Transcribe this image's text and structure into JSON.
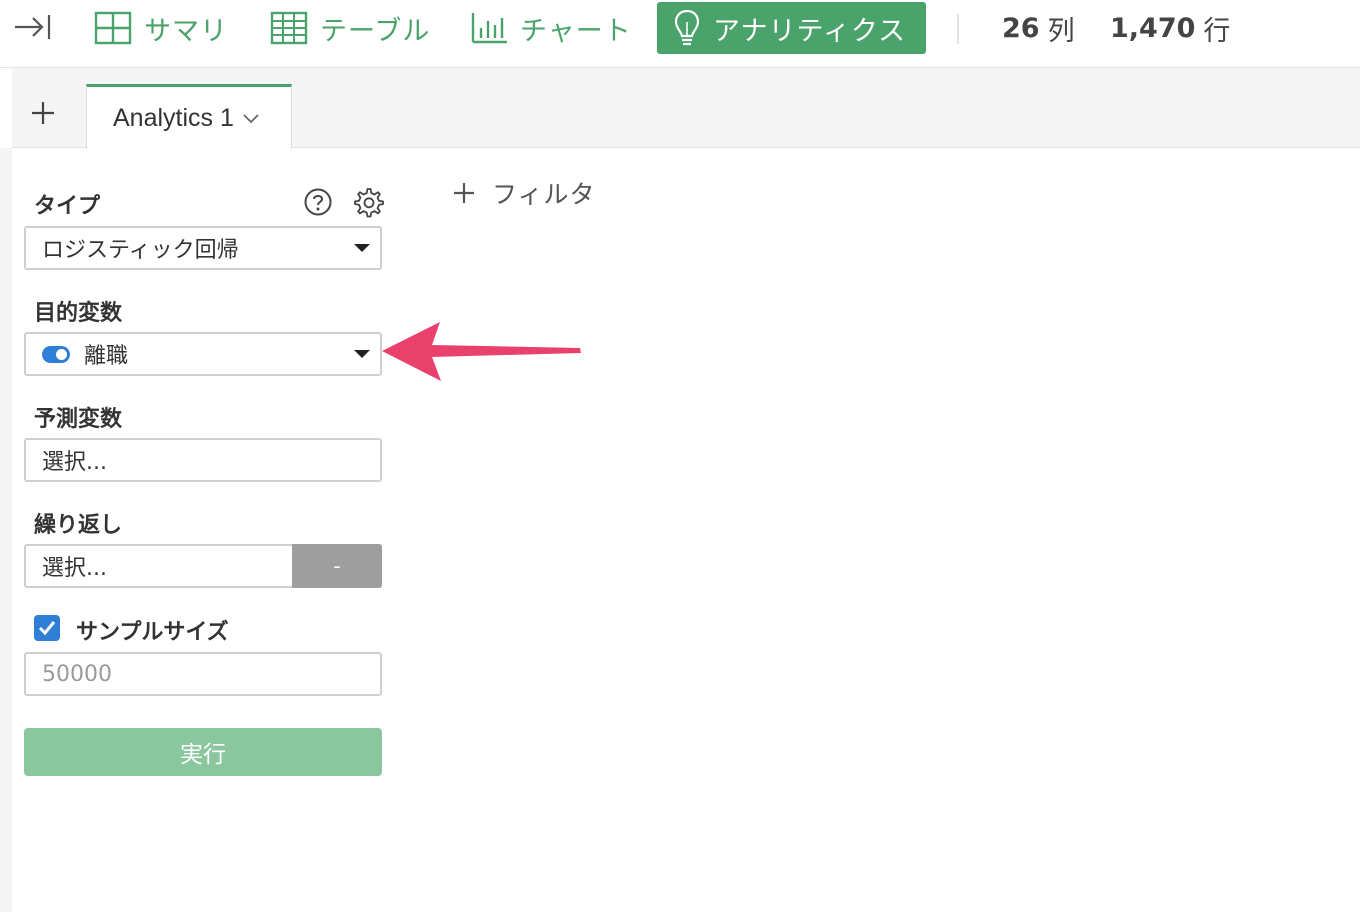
{
  "toolbar": {
    "nav": [
      {
        "label": "サマリ",
        "icon": "summary-grid-icon"
      },
      {
        "label": "テーブル",
        "icon": "table-icon"
      },
      {
        "label": "チャート",
        "icon": "bar-chart-icon"
      },
      {
        "label": "アナリティクス",
        "icon": "lightbulb-icon",
        "active": true
      }
    ],
    "columns": {
      "value": "26",
      "unit": "列"
    },
    "rows": {
      "value": "1,470",
      "unit": "行"
    }
  },
  "tabs": {
    "items": [
      {
        "label": "Analytics 1"
      }
    ]
  },
  "panel": {
    "type": {
      "label": "タイプ",
      "selected": "ロジスティック回帰"
    },
    "target": {
      "label": "目的変数",
      "selected": "離職"
    },
    "predictors": {
      "label": "予測変数",
      "placeholder": "選択..."
    },
    "repeat": {
      "label": "繰り返し",
      "placeholder": "選択...",
      "button": "-"
    },
    "sample_size": {
      "label": "サンプルサイズ",
      "checked": true,
      "placeholder": "50000"
    },
    "run_button": "実行"
  },
  "filter": {
    "label": "フィルタ"
  },
  "colors": {
    "accent": "#4aa36a",
    "toggle": "#2f7fd6",
    "arrow": "#e8416c"
  }
}
